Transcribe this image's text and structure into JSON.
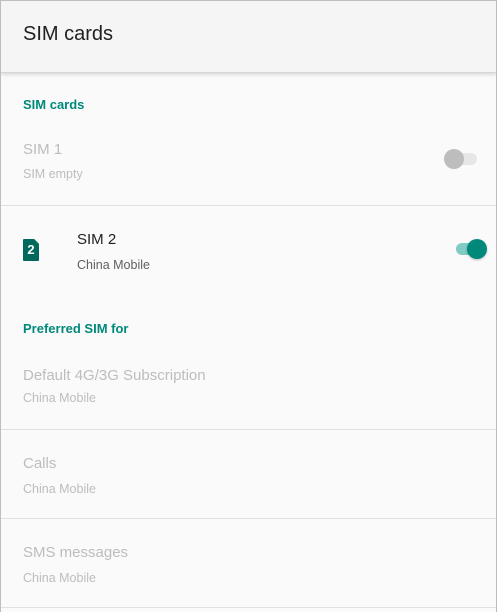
{
  "appbar": {
    "title": "SIM cards"
  },
  "sim_section": {
    "header": "SIM cards",
    "sim1": {
      "title": "SIM 1",
      "subtitle": "SIM empty",
      "switch_on": false
    },
    "sim2": {
      "slot_number": "2",
      "title": "SIM 2",
      "subtitle": "China Mobile",
      "switch_on": true
    }
  },
  "preferred_section": {
    "header": "Preferred SIM for",
    "items": [
      {
        "title": "Default 4G/3G Subscription",
        "subtitle": "China Mobile"
      },
      {
        "title": "Calls",
        "subtitle": "China Mobile"
      },
      {
        "title": "SMS messages",
        "subtitle": "China Mobile"
      }
    ]
  },
  "colors": {
    "accent": "#00897b",
    "accent_dark": "#00695c",
    "disabled_text": "#bdbdbd"
  }
}
